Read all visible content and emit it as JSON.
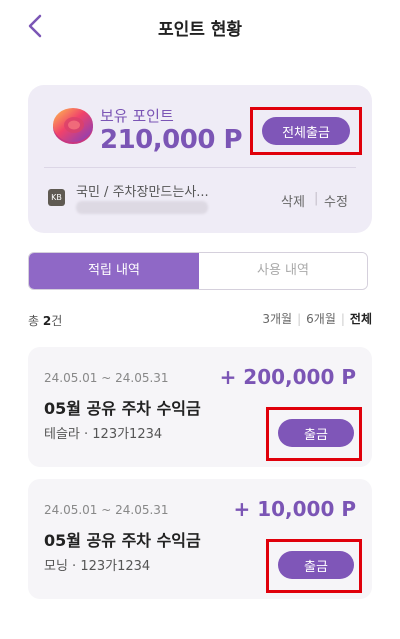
{
  "header": {
    "title": "포인트 현황"
  },
  "points_card": {
    "label": "보유 포인트",
    "amount": "210,000 P",
    "withdraw_all_label": "전체출금",
    "bank_name": "국민 / 주차장만드는사...",
    "bank_icon_text": "KB",
    "delete_label": "삭제",
    "separator": "|",
    "edit_label": "수정"
  },
  "tabs": [
    {
      "label": "적립 내역"
    },
    {
      "label": "사용 내역"
    }
  ],
  "summary": {
    "prefix": "총 ",
    "count": "2",
    "suffix": "건"
  },
  "filters": [
    "3개월",
    "6개월",
    "전체"
  ],
  "items": [
    {
      "period": "24.05.01 ~ 24.05.31",
      "amount": "+ 200,000 P",
      "name": "05월 공유 주차 수익금",
      "car": "테슬라 · 123가1234",
      "button_label": "출금"
    },
    {
      "period": "24.05.01 ~ 24.05.31",
      "amount": "+ 10,000 P",
      "name": "05월 공유 주차 수익금",
      "car": "모닝 · 123가1234",
      "button_label": "출금"
    }
  ]
}
